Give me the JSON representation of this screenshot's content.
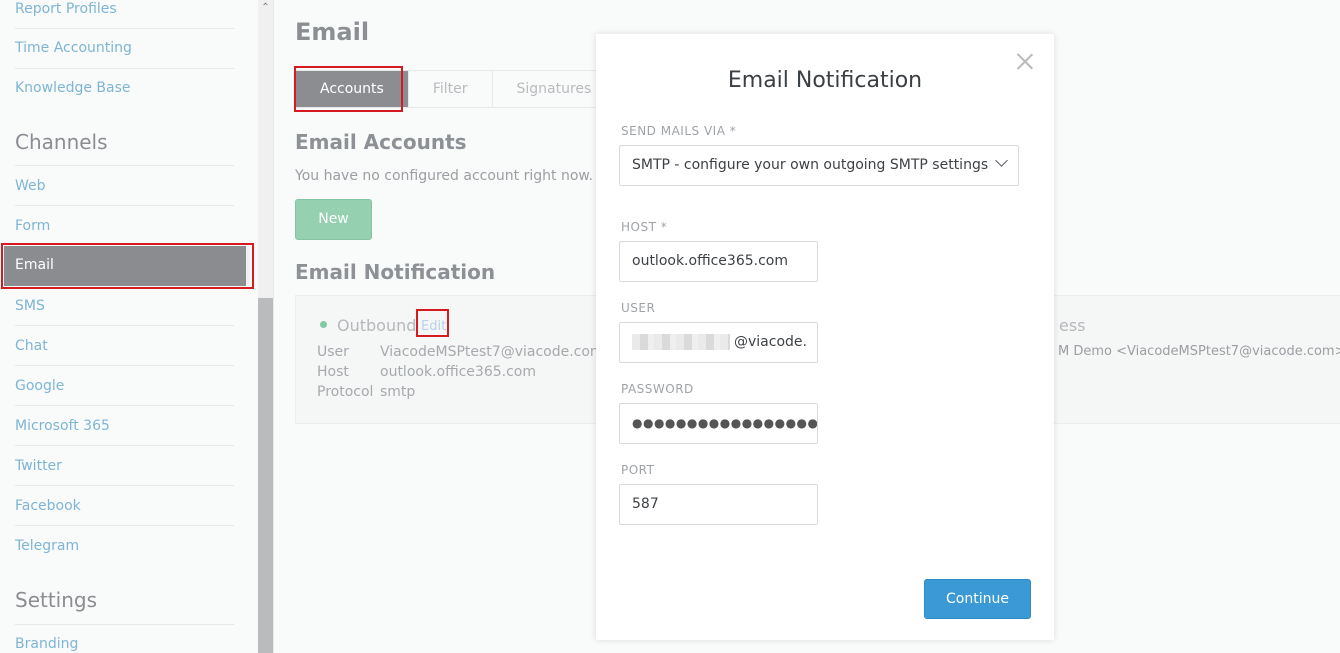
{
  "sidebar": {
    "items_top": [
      {
        "label": "Report Profiles"
      },
      {
        "label": "Time Accounting"
      },
      {
        "label": "Knowledge Base"
      }
    ],
    "channels_heading": "Channels",
    "channels": [
      {
        "label": "Web"
      },
      {
        "label": "Form"
      },
      {
        "label": "Email"
      },
      {
        "label": "SMS"
      },
      {
        "label": "Chat"
      },
      {
        "label": "Google"
      },
      {
        "label": "Microsoft 365"
      },
      {
        "label": "Twitter"
      },
      {
        "label": "Facebook"
      },
      {
        "label": "Telegram"
      }
    ],
    "settings_heading": "Settings",
    "settings": [
      {
        "label": "Branding"
      }
    ]
  },
  "main": {
    "title": "Email",
    "tabs": [
      {
        "label": "Accounts",
        "active": true
      },
      {
        "label": "Filter"
      },
      {
        "label": "Signatures"
      }
    ],
    "accounts_heading": "Email Accounts",
    "no_accounts_text": "You have no configured account right now.",
    "new_button": "New",
    "notification_heading": "Email Notification",
    "notification_card": {
      "outbound_label": "Outbound",
      "edit_label": "Edit",
      "rows": [
        {
          "key": "User",
          "value": "ViacodeMSPtest7@viacode.com"
        },
        {
          "key": "Host",
          "value": "outlook.office365.com"
        },
        {
          "key": "Protocol",
          "value": "smtp"
        }
      ],
      "address_label_partial": "ess",
      "from_partial": "M Demo <ViacodeMSPtest7@viacode.com>"
    }
  },
  "modal": {
    "title": "Email Notification",
    "send_via_label": "SEND MAILS VIA *",
    "send_via_value": "SMTP - configure your own outgoing SMTP settings",
    "host_label": "HOST *",
    "host_value": "outlook.office365.com",
    "user_label": "USER",
    "user_value_suffix": "@viacode.",
    "password_label": "PASSWORD",
    "password_value": "●●●●●●●●●●●●●●●●●●●●●●●",
    "port_label": "PORT",
    "port_value": "587",
    "continue_button": "Continue"
  },
  "colors": {
    "link": "#7fb5d4",
    "primary_button": "#3b9ad6",
    "active_tab": "#8b8d91",
    "highlight_box": "#d71920"
  }
}
